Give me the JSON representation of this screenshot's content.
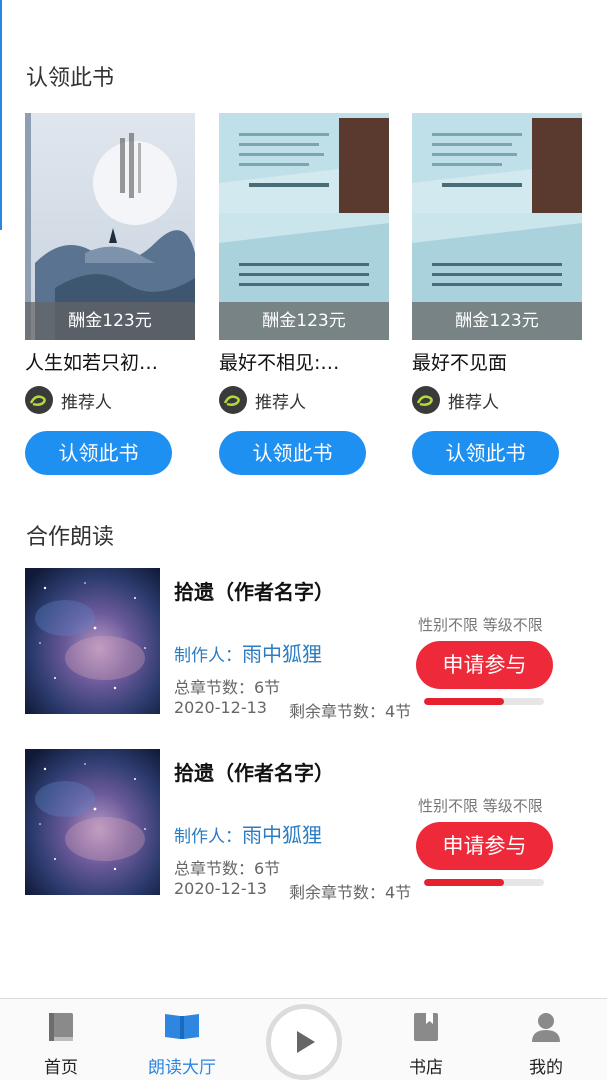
{
  "claim_section": {
    "title": "认领此书",
    "books": [
      {
        "title": "人生如若只初…",
        "reward": "酬金123元",
        "recommender": "推荐人",
        "button": "认领此书"
      },
      {
        "title": "最好不相见:…",
        "reward": "酬金123元",
        "recommender": "推荐人",
        "button": "认领此书"
      },
      {
        "title": "最好不见面",
        "reward": "酬金123元",
        "recommender": "推荐人",
        "button": "认领此书"
      }
    ]
  },
  "coop_section": {
    "title": "合作朗读",
    "items": [
      {
        "title": "拾遗（作者名字）",
        "restriction": "性别不限 等级不限",
        "producer_label": "制作人：",
        "producer_name": "雨中狐狸",
        "total_chapters": "总章节数：6节",
        "date": "2020-12-13",
        "remaining": "剩余章节数：4节",
        "button": "申请参与",
        "progress": 0.67
      },
      {
        "title": "拾遗（作者名字）",
        "restriction": "性别不限 等级不限",
        "producer_label": "制作人：",
        "producer_name": "雨中狐狸",
        "total_chapters": "总章节数：6节",
        "date": "2020-12-13",
        "remaining": "剩余章节数：4节",
        "button": "申请参与",
        "progress": 0.67
      }
    ]
  },
  "tabbar": {
    "tabs": [
      {
        "label": "首页",
        "icon": "book-icon",
        "active": false
      },
      {
        "label": "朗读大厅",
        "icon": "open-book-icon",
        "active": true
      },
      {
        "label": "书店",
        "icon": "bookmark-book-icon",
        "active": false
      },
      {
        "label": "我的",
        "icon": "user-icon",
        "active": false
      }
    ],
    "center_icon": "play-icon"
  },
  "colors": {
    "accent_blue": "#1e90f2",
    "accent_red": "#ee2a3a",
    "producer_blue": "#2b7cc2"
  }
}
